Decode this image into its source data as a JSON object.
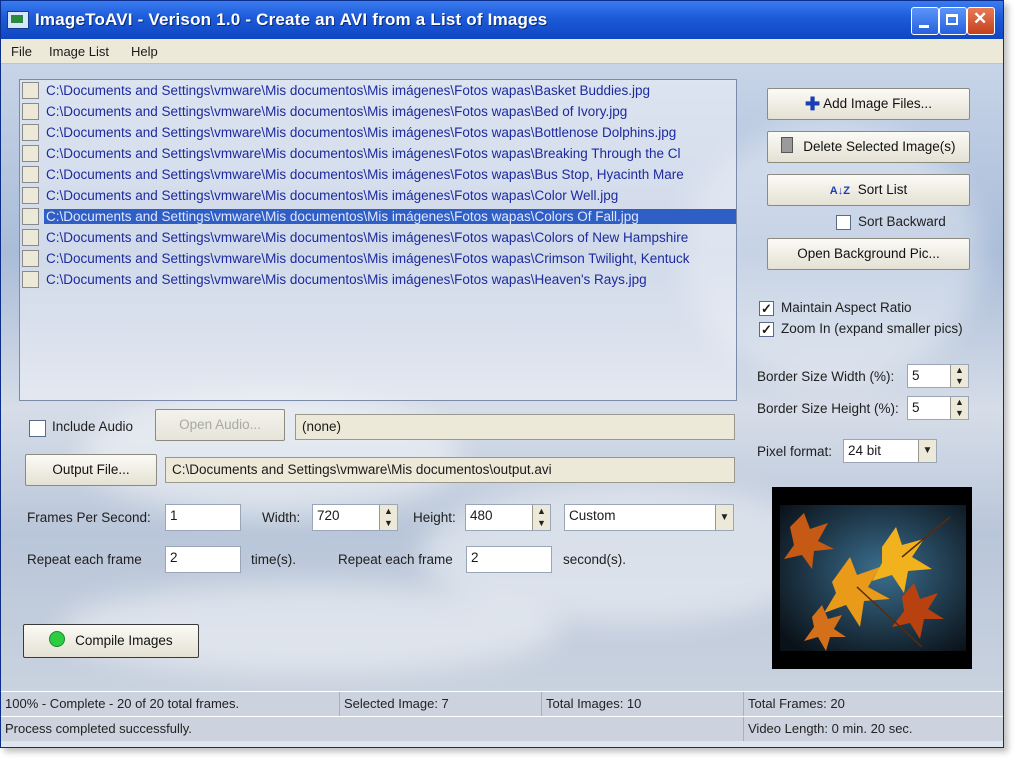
{
  "window": {
    "title": "ImageToAVI - Verison 1.0 - Create an AVI from a List of Images"
  },
  "menu": {
    "items": [
      "File",
      "Image List",
      "Help"
    ]
  },
  "file_list": {
    "items": [
      "C:\\Documents and Settings\\vmware\\Mis documentos\\Mis imágenes\\Fotos wapas\\Basket Buddies.jpg",
      "C:\\Documents and Settings\\vmware\\Mis documentos\\Mis imágenes\\Fotos wapas\\Bed of Ivory.jpg",
      "C:\\Documents and Settings\\vmware\\Mis documentos\\Mis imágenes\\Fotos wapas\\Bottlenose Dolphins.jpg",
      "C:\\Documents and Settings\\vmware\\Mis documentos\\Mis imágenes\\Fotos wapas\\Breaking Through the Cl",
      "C:\\Documents and Settings\\vmware\\Mis documentos\\Mis imágenes\\Fotos wapas\\Bus Stop, Hyacinth Mare",
      "C:\\Documents and Settings\\vmware\\Mis documentos\\Mis imágenes\\Fotos wapas\\Color Well.jpg",
      "C:\\Documents and Settings\\vmware\\Mis documentos\\Mis imágenes\\Fotos wapas\\Colors Of Fall.jpg",
      "C:\\Documents and Settings\\vmware\\Mis documentos\\Mis imágenes\\Fotos wapas\\Colors of New Hampshire",
      "C:\\Documents and Settings\\vmware\\Mis documentos\\Mis imágenes\\Fotos wapas\\Crimson Twilight, Kentuck",
      "C:\\Documents and Settings\\vmware\\Mis documentos\\Mis imágenes\\Fotos wapas\\Heaven's Rays.jpg"
    ],
    "selected_index": 6
  },
  "buttons": {
    "add_images": "Add Image Files...",
    "delete_selected": "Delete Selected Image(s)",
    "sort_list": "Sort List",
    "open_background": "Open Background Pic...",
    "open_audio": "Open Audio...",
    "output_file": "Output File...",
    "compile": "Compile Images"
  },
  "options": {
    "sort_backward": "Sort Backward",
    "sort_backward_checked": false,
    "maintain_aspect": "Maintain Aspect Ratio",
    "maintain_aspect_checked": true,
    "zoom_in": "Zoom In (expand smaller pics)",
    "zoom_in_checked": true,
    "include_audio": "Include Audio",
    "include_audio_checked": false
  },
  "border": {
    "width_label": "Border Size Width (%):",
    "width_value": "5",
    "height_label": "Border Size Height (%):",
    "height_value": "5"
  },
  "pixel_format": {
    "label": "Pixel format:",
    "value": "24 bit"
  },
  "audio_path": "(none)",
  "output_path": "C:\\Documents and Settings\\vmware\\Mis documentos\\output.avi",
  "video": {
    "fps_label": "Frames Per Second:",
    "fps_value": "1",
    "width_label": "Width:",
    "width_value": "720",
    "height_label": "Height:",
    "height_value": "480",
    "size_preset": "Custom",
    "repeat_label_1": "Repeat each frame",
    "repeat_times_value": "2",
    "repeat_times_unit": "time(s).",
    "repeat_label_2": "Repeat each frame",
    "repeat_seconds_value": "2",
    "repeat_seconds_unit": "second(s)."
  },
  "status": {
    "progress": "100% - Complete - 20 of 20 total frames.",
    "selected_image": "Selected Image: 7",
    "total_images": "Total Images: 10",
    "total_frames": "Total Frames: 20",
    "message": "Process completed successfully.",
    "video_length": "Video Length: 0 min. 20 sec."
  },
  "colors": {
    "titlebar": "#1c5ad8",
    "selection": "#2f5fc4",
    "list_text": "#1d2a9e",
    "compile_indicator": "#2ecc40"
  }
}
